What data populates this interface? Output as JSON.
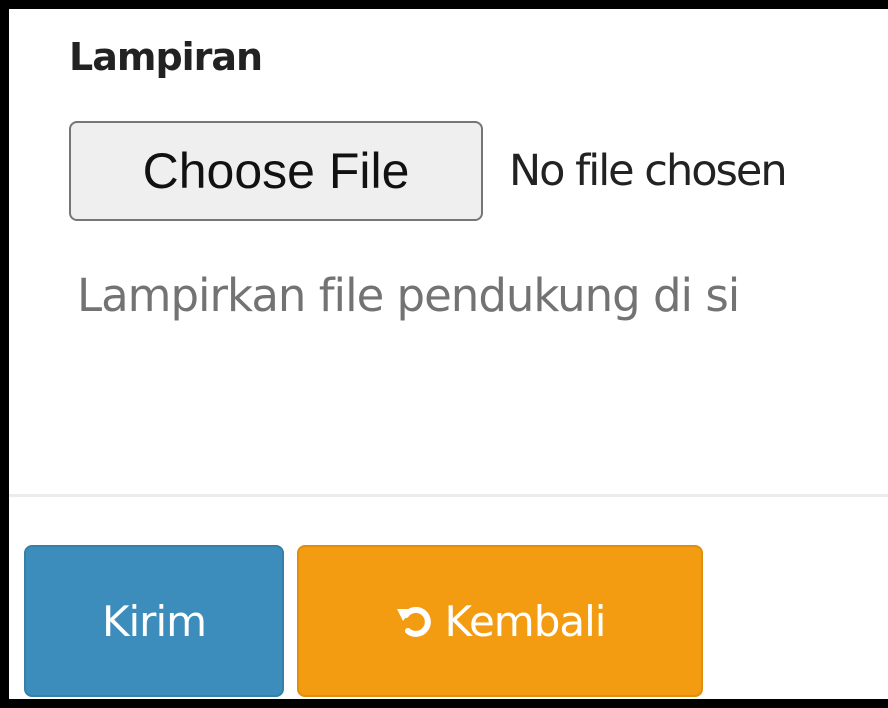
{
  "form": {
    "attachment_label": "Lampiran",
    "file_button_label": "Choose File",
    "file_status": "No file chosen",
    "help_text": "Lampirkan file pendukung di si"
  },
  "actions": {
    "submit_label": "Kirim",
    "back_label": "Kembali",
    "back_icon": "undo-icon"
  },
  "colors": {
    "submit_bg": "#3c8dbc",
    "back_bg": "#f39c12"
  }
}
